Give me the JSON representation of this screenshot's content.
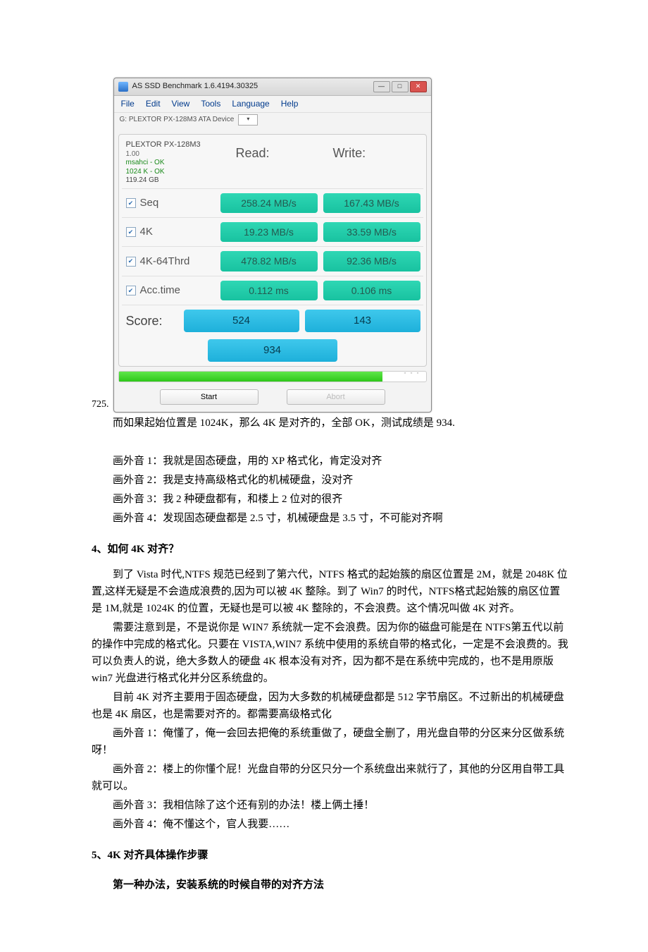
{
  "fig_number": "725.",
  "window": {
    "title": "AS SSD Benchmark 1.6.4194.30325",
    "menu": [
      "File",
      "Edit",
      "View",
      "Tools",
      "Language",
      "Help"
    ],
    "drive_label": "G:  PLEXTOR  PX-128M3 ATA Device",
    "device": {
      "name": "PLEXTOR PX-128M3",
      "version": "1.00",
      "driver": "msahci - OK",
      "align": "1024 K - OK",
      "size": "119.24 GB"
    },
    "col_read": "Read:",
    "col_write": "Write:",
    "rows": [
      {
        "label": "Seq",
        "read": "258.24 MB/s",
        "write": "167.43 MB/s"
      },
      {
        "label": "4K",
        "read": "19.23 MB/s",
        "write": "33.59 MB/s"
      },
      {
        "label": "4K-64Thrd",
        "read": "478.82 MB/s",
        "write": "92.36 MB/s"
      },
      {
        "label": "Acc.time",
        "read": "0.112 ms",
        "write": "0.106 ms"
      }
    ],
    "score_label": "Score:",
    "score_read": "524",
    "score_write": "143",
    "score_total": "934",
    "btn_start": "Start",
    "btn_abort": "Abort"
  },
  "article": {
    "after_fig": "而如果起始位置是 1024K，那么 4K 是对齐的，全部 OK，测试成绩是 934.",
    "v1": "画外音 1：我就是固态硬盘，用的 XP 格式化，肯定没对齐",
    "v2": "画外音 2：我是支持高级格式化的机械硬盘，没对齐",
    "v3": "画外音 3：我 2 种硬盘都有，和楼上 2 位对的很齐",
    "v4": "画外音 4：发现固态硬盘都是 2.5 寸，机械硬盘是 3.5 寸，不可能对齐啊",
    "h4": "4、如何 4K 对齐？",
    "p4a": "到了 Vista 时代,NTFS 规范已经到了第六代，NTFS 格式的起始簇的扇区位置是 2M，就是 2048K 位置,这样无疑是不会造成浪费的,因为可以被 4K 整除。到了 Win7 的时代，NTFS格式起始簇的扇区位置是 1M,就是 1024K 的位置，无疑也是可以被 4K 整除的，不会浪费。这个情况叫做 4K 对齐。",
    "p4b": "需要注意到是，不是说你是 WIN7 系统就一定不会浪费。因为你的磁盘可能是在 NTFS第五代以前的操作中完成的格式化。只要在 VISTA,WIN7 系统中使用的系统自带的格式化，一定是不会浪费的。我可以负责人的说，绝大多数人的硬盘 4K 根本没有对齐，因为都不是在系统中完成的，也不是用原版 win7 光盘进行格式化并分区系统盘的。",
    "p4c": "目前 4K 对齐主要用于固态硬盘，因为大多数的机械硬盘都是 512 字节扇区。不过新出的机械硬盘也是 4K 扇区，也是需要对齐的。都需要高级格式化",
    "p4d": "画外音 1：俺懂了，俺一会回去把俺的系统重做了，硬盘全删了，用光盘自带的分区来分区做系统呀！",
    "p4e": "画外音 2：楼上的你懂个屁！光盘自带的分区只分一个系统盘出来就行了，其他的分区用自带工具就可以。",
    "p4f": "画外音 3：我相信除了这个还有别的办法！楼上俩土捶！",
    "p4g": "画外音 4：俺不懂这个，官人我要……",
    "h5": "5、4K 对齐具体操作步骤",
    "p5a": "第一种办法，安装系统的时候自带的对齐方法"
  }
}
